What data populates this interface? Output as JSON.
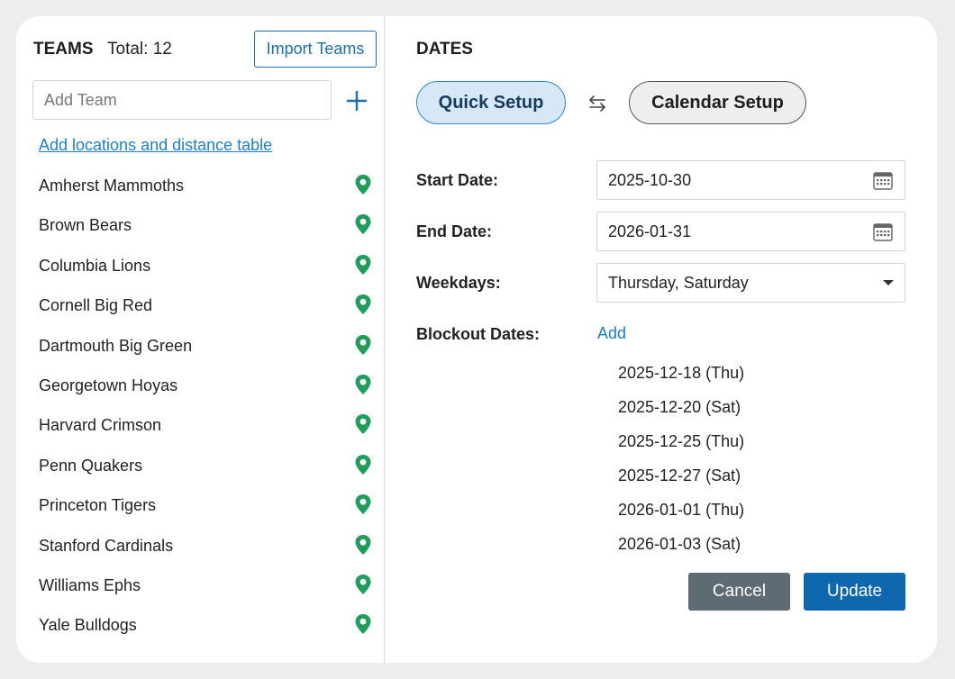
{
  "teams": {
    "heading": "TEAMS",
    "total": "Total: 12",
    "import_label": "Import Teams",
    "add_placeholder": "Add Team",
    "locations_link": "Add locations and distance table ",
    "items": [
      {
        "name": "Amherst Mammoths",
        "icon": "map-pin-icon"
      },
      {
        "name": "Brown Bears",
        "icon": "map-pin-icon"
      },
      {
        "name": "Columbia Lions",
        "icon": "map-pin-icon"
      },
      {
        "name": "Cornell Big Red",
        "icon": "map-pin-icon"
      },
      {
        "name": "Dartmouth Big Green",
        "icon": "map-pin-icon"
      },
      {
        "name": "Georgetown Hoyas",
        "icon": "map-pin-icon"
      },
      {
        "name": "Harvard Crimson",
        "icon": "map-pin-icon"
      },
      {
        "name": "Penn Quakers",
        "icon": "map-pin-icon"
      },
      {
        "name": "Princeton Tigers",
        "icon": "map-pin-icon"
      },
      {
        "name": "Stanford Cardinals",
        "icon": "map-pin-icon"
      },
      {
        "name": "Williams Ephs",
        "icon": "map-pin-icon"
      },
      {
        "name": "Yale Bulldogs",
        "icon": "map-pin-icon"
      }
    ]
  },
  "dates": {
    "heading": "DATES",
    "quick_setup_label": "Quick Setup",
    "calendar_setup_label": "Calendar Setup",
    "start_date_label": "Start Date:",
    "start_date_value": "2025-10-30",
    "end_date_label": "End Date:",
    "end_date_value": "2026-01-31",
    "weekdays_label": "Weekdays:",
    "weekdays_value": "Thursday, Saturday",
    "blockout_label": "Blockout Dates:",
    "blockout_add_label": "Add",
    "blockout_dates": [
      "2025-12-18 (Thu)",
      "2025-12-20 (Sat)",
      "2025-12-25 (Thu)",
      "2025-12-27 (Sat)",
      "2026-01-01 (Thu)",
      "2026-01-03 (Sat)"
    ]
  },
  "actions": {
    "cancel_label": "Cancel",
    "update_label": "Update"
  },
  "colors": {
    "accent": "#1a6fb3",
    "link": "#1a7fd0",
    "pin": "#1e9e5a",
    "update_bg": "#0f68ad",
    "cancel_bg": "#5f6b72",
    "quick_setup_bg": "#d6e8f5"
  }
}
